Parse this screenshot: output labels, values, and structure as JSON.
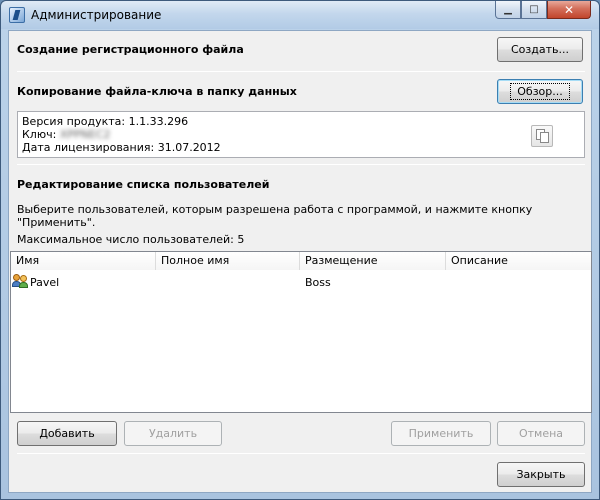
{
  "window": {
    "title": "Администрирование",
    "caption_buttons": {
      "minimize": "▁",
      "maximize": "□",
      "close": "✕"
    }
  },
  "registration": {
    "heading": "Создание регистрационного файла",
    "create_label": "Создать..."
  },
  "keyfile": {
    "heading": "Копирование файла-ключа в папку данных",
    "browse_label": "Обзор...",
    "version_line": "Версия продукта: 1.1.33.296",
    "key_label": "Ключ:",
    "key_value": "XPPNEC2",
    "license_date_line": "Дата лицензирования: 31.07.2012"
  },
  "users": {
    "heading": "Редактирование списка пользователей",
    "instruction": "Выберите пользователей, которым разрешена работа с программой, и нажмите кнопку \"Применить\".",
    "max_users_line": "Максимальное число пользователей: 5",
    "columns": [
      "Имя",
      "Полное имя",
      "Размещение",
      "Описание"
    ],
    "rows": [
      {
        "name": "Pavel",
        "full_name": "",
        "location": "Boss",
        "description": "",
        "icon": "users-group-icon"
      }
    ]
  },
  "actions": {
    "add_label": "Добавить",
    "delete_label": "Удалить",
    "apply_label": "Применить",
    "cancel_label": "Отмена",
    "close_label": "Закрыть"
  }
}
